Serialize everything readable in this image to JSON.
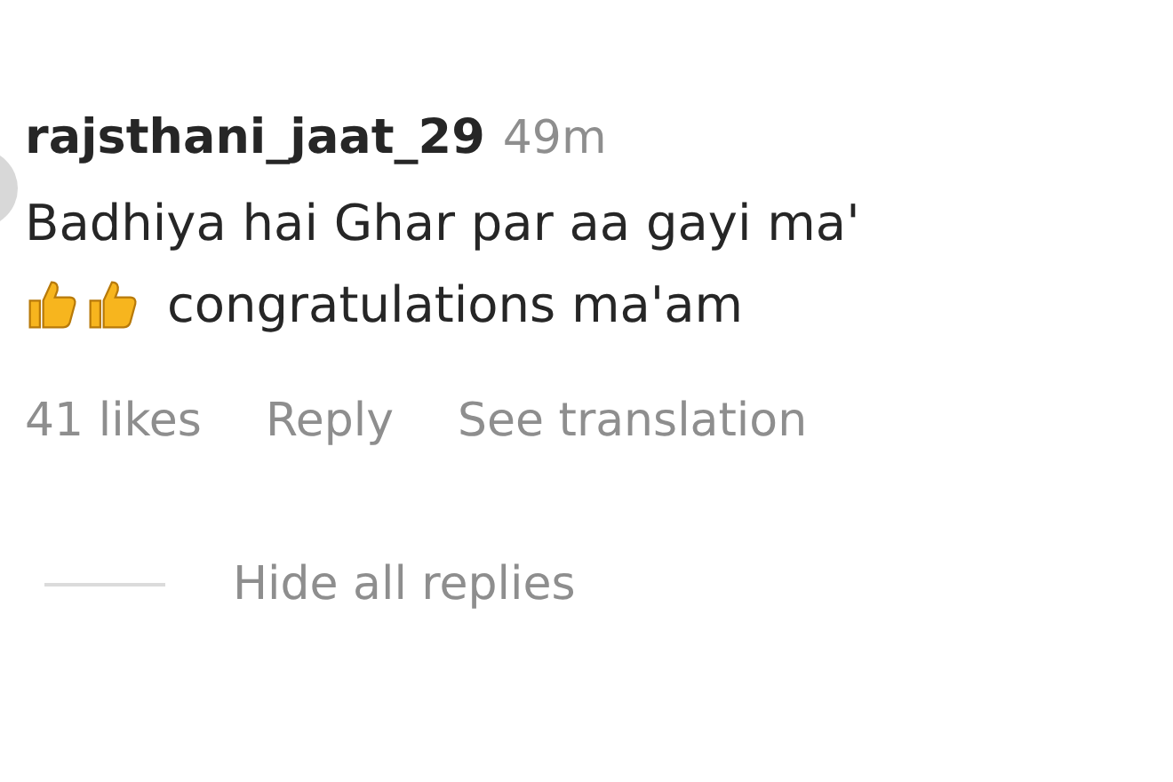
{
  "comment": {
    "username": "rajsthani_jaat_29",
    "time": "49m",
    "lines": [
      {
        "text": "Badhiya hai Ghar par aa gayi ma'"
      },
      {
        "text": "congratulations ma'am",
        "emoji": [
          {
            "kind": "thumbs-up"
          },
          {
            "kind": "thumbs-up"
          }
        ]
      }
    ],
    "actions": [
      "41 likes",
      "Reply",
      "See translation"
    ]
  },
  "replies_toggle": "Hide all replies"
}
